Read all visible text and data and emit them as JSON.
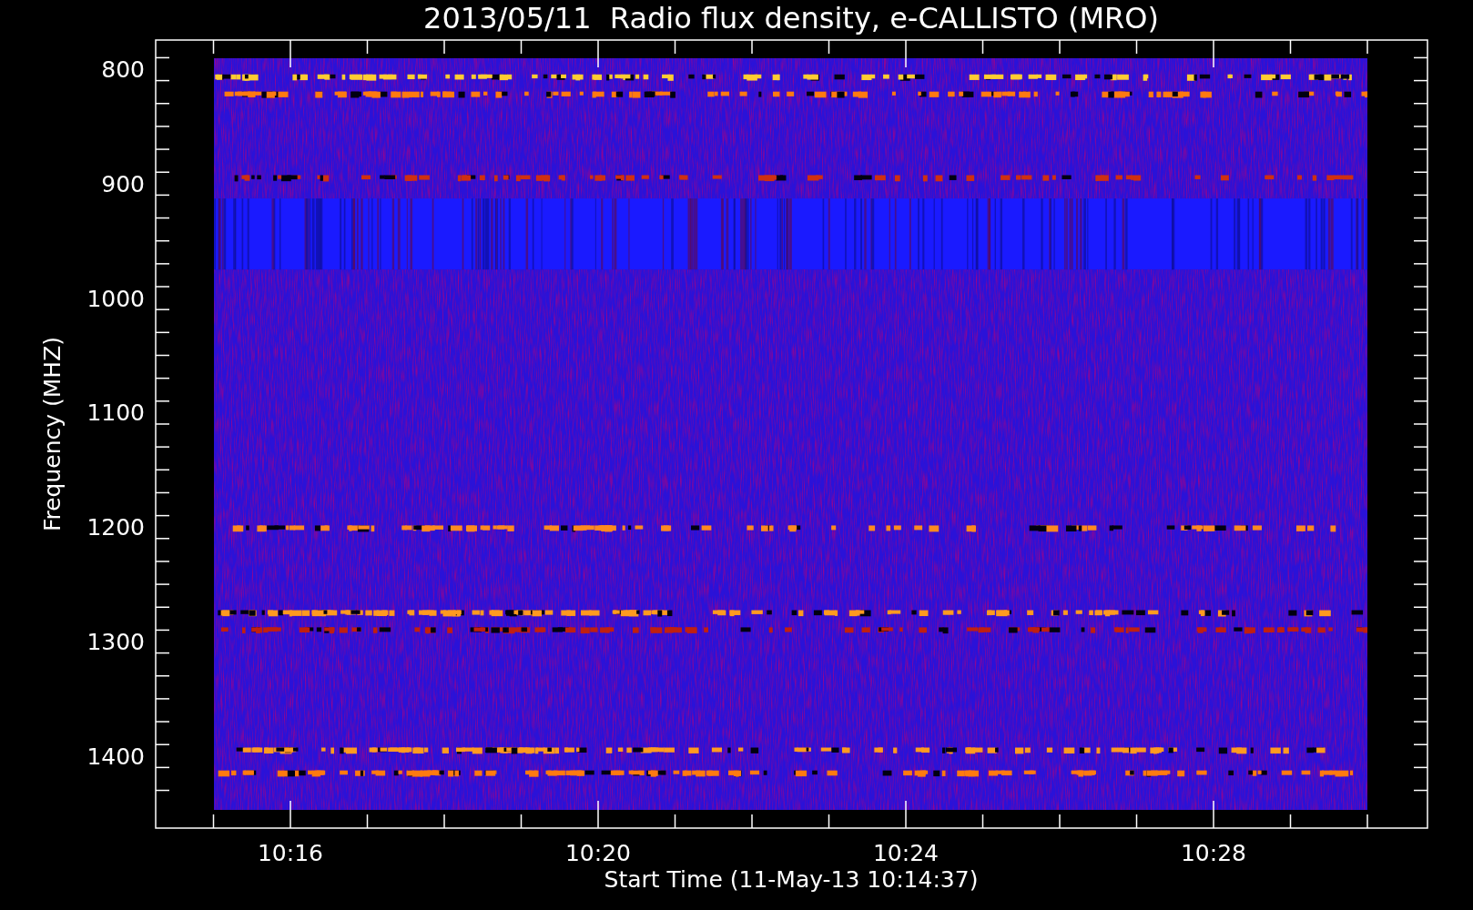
{
  "plot": {
    "title": "2013/05/11  Radio flux density, e-CALLISTO (MRO)",
    "ylabel": "Frequency (MHZ)",
    "xlabel": "Start Time (11-May-13 10:14:37)",
    "yticks": [
      "800",
      "900",
      "1000",
      "1100",
      "1200",
      "1300",
      "1400"
    ],
    "xticks": [
      "10:16",
      "10:20",
      "10:24",
      "10:28"
    ]
  }
}
